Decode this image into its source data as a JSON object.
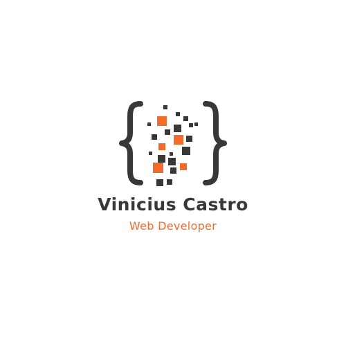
{
  "logo": {
    "name": "Vinicius Castro",
    "tagline": "Web Developer",
    "icon": "code-braces-pixel-icon",
    "colors": {
      "dark": "#383838",
      "accent": "#f26b2b",
      "background": "#ffffff"
    }
  }
}
